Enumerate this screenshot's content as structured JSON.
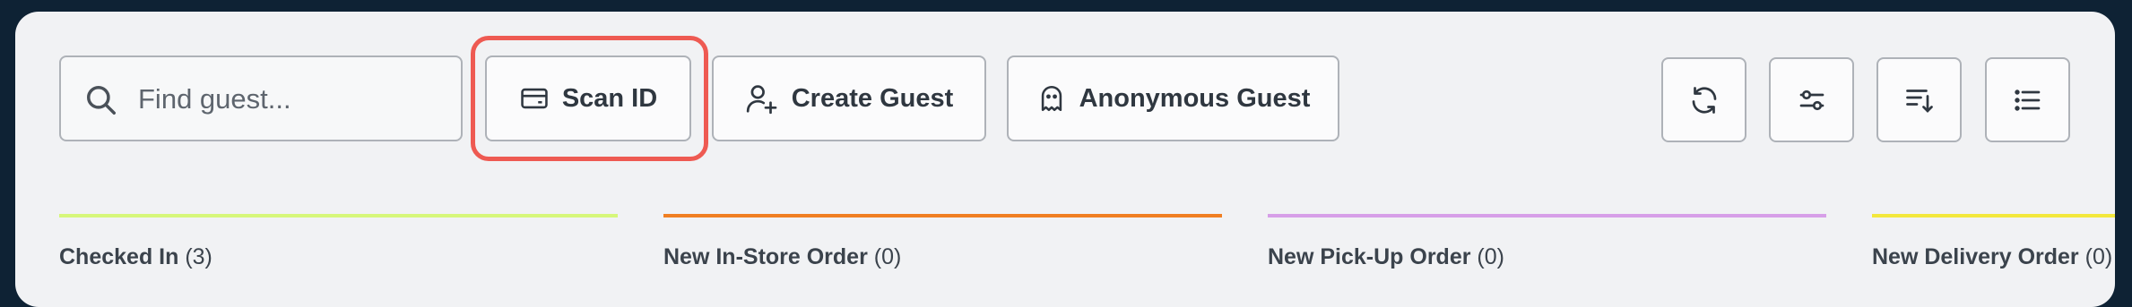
{
  "search": {
    "placeholder": "Find guest..."
  },
  "toolbar": {
    "scan_id_label": "Scan ID",
    "create_guest_label": "Create Guest",
    "anonymous_guest_label": "Anonymous Guest"
  },
  "icons": [
    "search-icon",
    "id-card-icon",
    "user-plus-icon",
    "ghost-icon",
    "refresh-icon",
    "filter-sliders-icon",
    "sort-icon",
    "list-view-icon"
  ],
  "columns": [
    {
      "label": "Checked In",
      "count": "(3)",
      "color": "#d6f77a"
    },
    {
      "label": "New In-Store Order",
      "count": "(0)",
      "color": "#f07f22"
    },
    {
      "label": "New Pick-Up Order",
      "count": "(0)",
      "color": "#d79fe8"
    },
    {
      "label": "New Delivery Order",
      "count": "(0)",
      "color": "#f3e83c"
    }
  ],
  "colors": {
    "highlight": "#ee5a52",
    "panel": "#f1f2f4",
    "frame": "#0e2234"
  }
}
